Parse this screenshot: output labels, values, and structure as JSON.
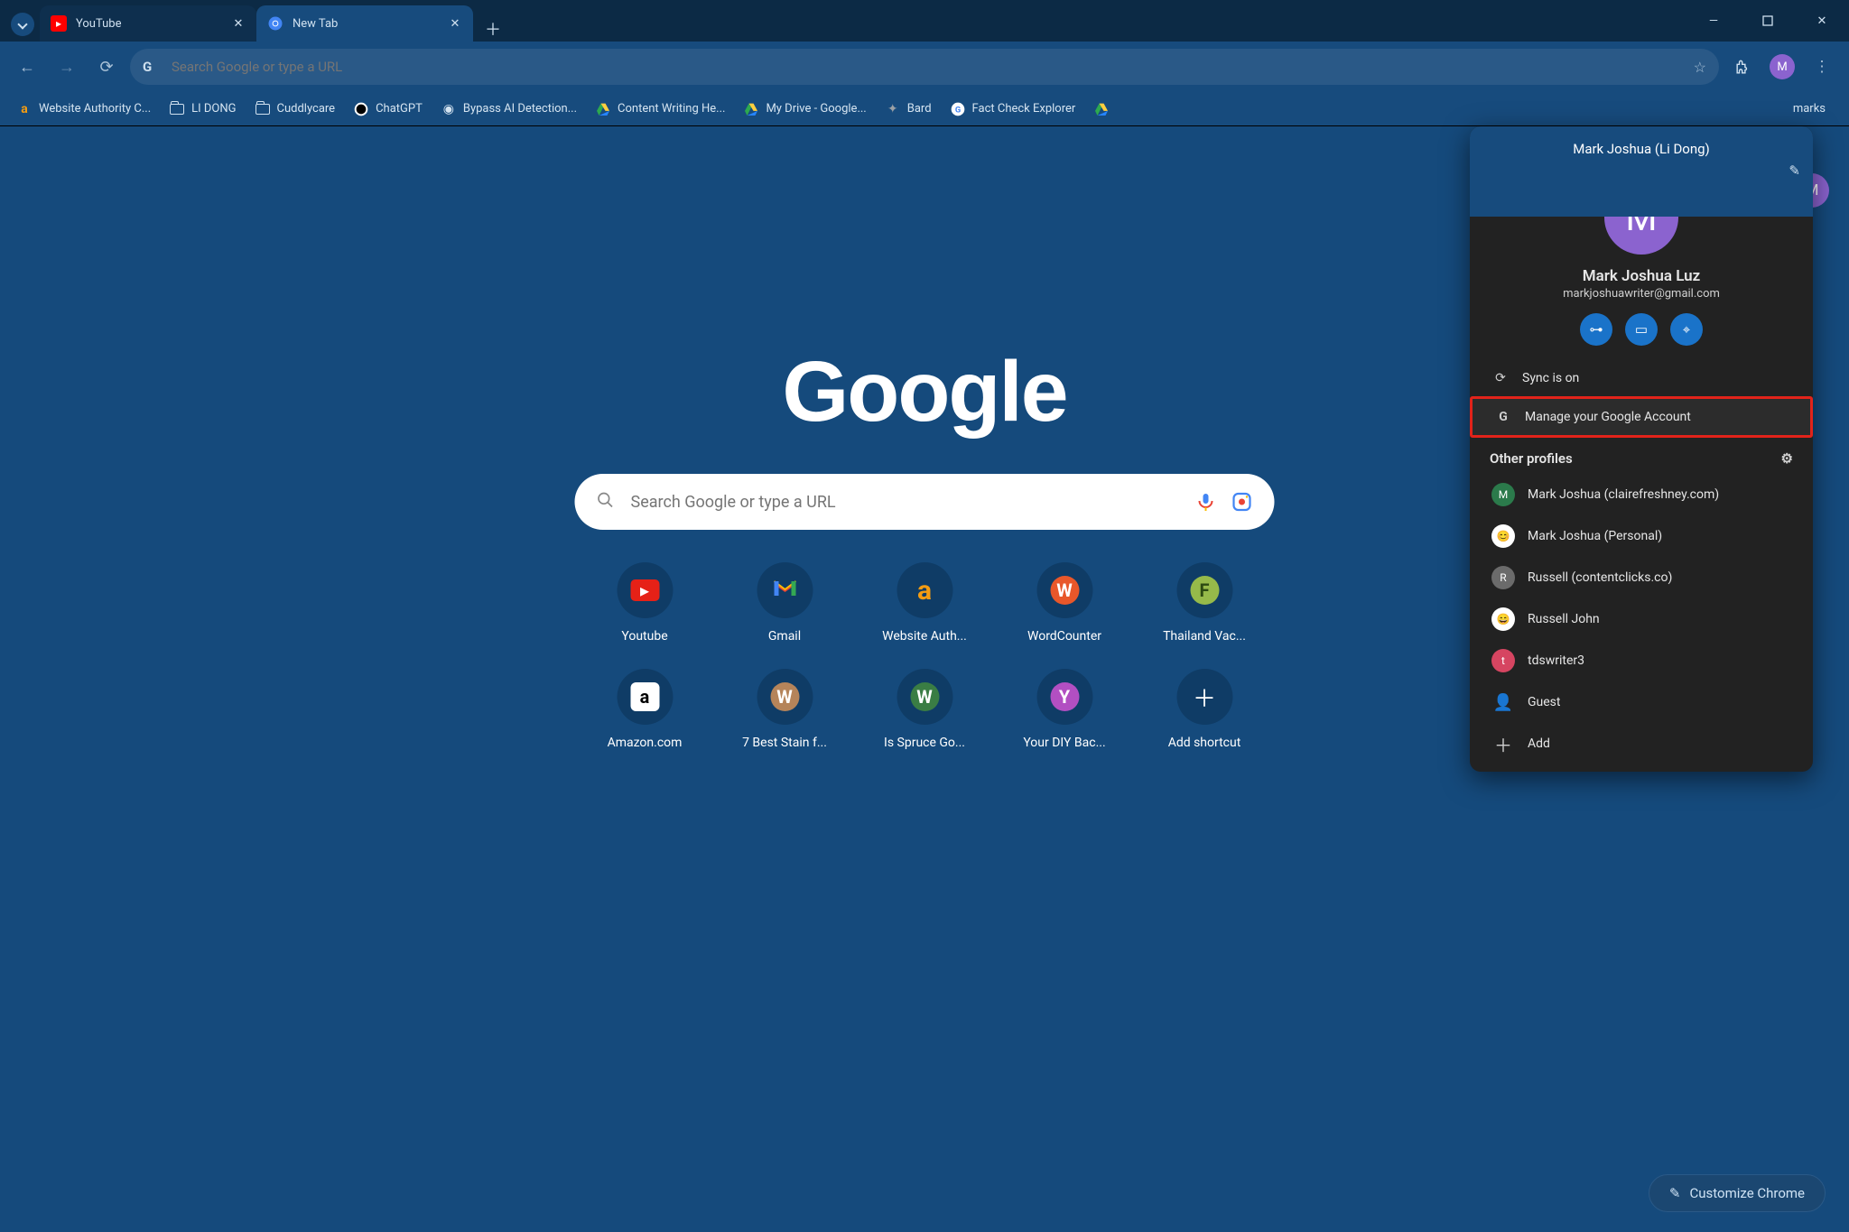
{
  "window": {
    "minimize_tooltip": "Minimize",
    "maximize_tooltip": "Maximize",
    "close_tooltip": "Close"
  },
  "tabs": [
    {
      "title": "YouTube",
      "active": false,
      "favicon": "youtube"
    },
    {
      "title": "New Tab",
      "active": true,
      "favicon": "chrome"
    }
  ],
  "toolbar": {
    "omnibox_placeholder": "Search Google or type a URL",
    "profile_initial": "M"
  },
  "bookmarks": [
    {
      "label": "Website Authority C...",
      "icon": "a-orange"
    },
    {
      "label": "LI DONG",
      "icon": "folder"
    },
    {
      "label": "Cuddlycare",
      "icon": "folder"
    },
    {
      "label": "ChatGPT",
      "icon": "chatgpt"
    },
    {
      "label": "Bypass AI Detection...",
      "icon": "sphere"
    },
    {
      "label": "Content Writing He...",
      "icon": "drive"
    },
    {
      "label": "My Drive - Google...",
      "icon": "drive"
    },
    {
      "label": "Bard",
      "icon": "spark"
    },
    {
      "label": "Fact Check Explorer",
      "icon": "g-circle"
    },
    {
      "label": "",
      "icon": "drive"
    }
  ],
  "bookmarks_overflow_label": "marks",
  "ntp": {
    "logo_text": "Google",
    "search_placeholder": "Search Google or type a URL",
    "avatar_initial": "M",
    "customize_label": "Customize Chrome",
    "shortcuts": [
      {
        "label": "Youtube",
        "glyph": "▶",
        "bg": "#e62117"
      },
      {
        "label": "Gmail",
        "glyph": "M",
        "bg": "multicolor"
      },
      {
        "label": "Website Auth...",
        "glyph": "a",
        "bg": "#f39c12"
      },
      {
        "label": "WordCounter",
        "glyph": "W",
        "bg": "#e8572a"
      },
      {
        "label": "Thailand Vac...",
        "glyph": "F",
        "bg": "#96ba4a"
      },
      {
        "label": "Amazon.com",
        "glyph": "a",
        "bg": "#ffffff"
      },
      {
        "label": "7 Best Stain f...",
        "glyph": "W",
        "bg": "#b5845a"
      },
      {
        "label": "Is Spruce Go...",
        "glyph": "W",
        "bg": "#3a7d44"
      },
      {
        "label": "Your DIY Bac...",
        "glyph": "Y",
        "bg": "#b24fc2"
      },
      {
        "label": "Add shortcut",
        "glyph": "+",
        "bg": "add"
      }
    ]
  },
  "profile_panel": {
    "profile_label": "Mark Joshua (Li Dong)",
    "avatar_initial": "M",
    "full_name": "Mark Joshua Luz",
    "email": "markjoshuawriter@gmail.com",
    "sync_label": "Sync is on",
    "manage_label": "Manage your Google Account",
    "other_profiles_label": "Other profiles",
    "profiles": [
      {
        "name": "Mark Joshua (clairefreshney.com)",
        "initial": "M",
        "color": "#2b7a4b"
      },
      {
        "name": "Mark Joshua (Personal)",
        "initial": "",
        "color": "#ffffff",
        "image": true
      },
      {
        "name": "Russell (contentclicks.co)",
        "initial": "R",
        "color": "#6b6b6b"
      },
      {
        "name": "Russell John",
        "initial": "",
        "color": "#ffffff",
        "image": true
      },
      {
        "name": "tdswriter3",
        "initial": "t",
        "color": "#d64561"
      }
    ],
    "guest_label": "Guest",
    "add_label": "Add"
  }
}
